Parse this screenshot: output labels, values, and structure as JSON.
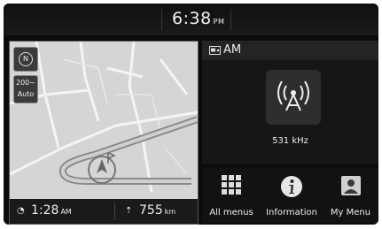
{
  "status_bar": {
    "time": "6:38",
    "ampm": "PM"
  },
  "map": {
    "compass_label": "N",
    "scale_value": "200~",
    "scale_mode": "Auto",
    "eta_time": "1:28",
    "eta_unit": "AM",
    "distance_value": "755",
    "distance_unit": "km"
  },
  "radio": {
    "source": "AM",
    "frequency": "531 kHz"
  },
  "menu": [
    {
      "label": "All menus",
      "icon": "grid-icon"
    },
    {
      "label": "Information",
      "icon": "info-icon"
    },
    {
      "label": "My Menu",
      "icon": "my-menu-icon"
    }
  ]
}
